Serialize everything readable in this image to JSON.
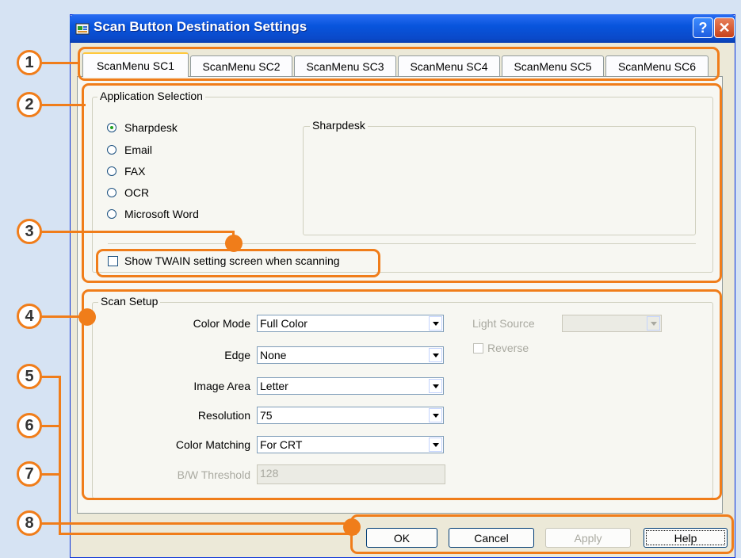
{
  "window": {
    "title": "Scan Button Destination Settings",
    "help_glyph": "?",
    "close_glyph": "✕"
  },
  "tabs": [
    {
      "label": "ScanMenu SC1",
      "active": true
    },
    {
      "label": "ScanMenu SC2",
      "active": false
    },
    {
      "label": "ScanMenu SC3",
      "active": false
    },
    {
      "label": "ScanMenu SC4",
      "active": false
    },
    {
      "label": "ScanMenu SC5",
      "active": false
    },
    {
      "label": "ScanMenu SC6",
      "active": false
    }
  ],
  "app_selection": {
    "legend": "Application Selection",
    "options": [
      {
        "label": "Sharpdesk",
        "selected": true
      },
      {
        "label": "Email",
        "selected": false
      },
      {
        "label": "FAX",
        "selected": false
      },
      {
        "label": "OCR",
        "selected": false
      },
      {
        "label": "Microsoft Word",
        "selected": false
      }
    ],
    "detail_legend": "Sharpdesk",
    "twain_checkbox": {
      "label": "Show TWAIN setting screen when scanning",
      "checked": false
    }
  },
  "scan_setup": {
    "legend": "Scan Setup",
    "color_mode": {
      "label": "Color Mode",
      "value": "Full Color"
    },
    "edge": {
      "label": "Edge",
      "value": "None"
    },
    "image_area": {
      "label": "Image Area",
      "value": "Letter"
    },
    "resolution": {
      "label": "Resolution",
      "value": "75"
    },
    "color_matching": {
      "label": "Color Matching",
      "value": "For CRT"
    },
    "bw_threshold": {
      "label": "B/W Threshold",
      "value": "128",
      "enabled": false
    },
    "light_source": {
      "label": "Light Source",
      "value": "",
      "enabled": false
    },
    "reverse": {
      "label": "Reverse",
      "checked": false,
      "enabled": false
    }
  },
  "buttons": {
    "ok": "OK",
    "cancel": "Cancel",
    "apply": "Apply",
    "help": "Help"
  },
  "callouts": [
    "1",
    "2",
    "3",
    "4",
    "5",
    "6",
    "7",
    "8"
  ],
  "colors": {
    "callout_orange": "#f07d1a",
    "titlebar_blue": "#0a49c9",
    "tab_highlight": "#ffc83c",
    "background": "#d6e3f3"
  }
}
